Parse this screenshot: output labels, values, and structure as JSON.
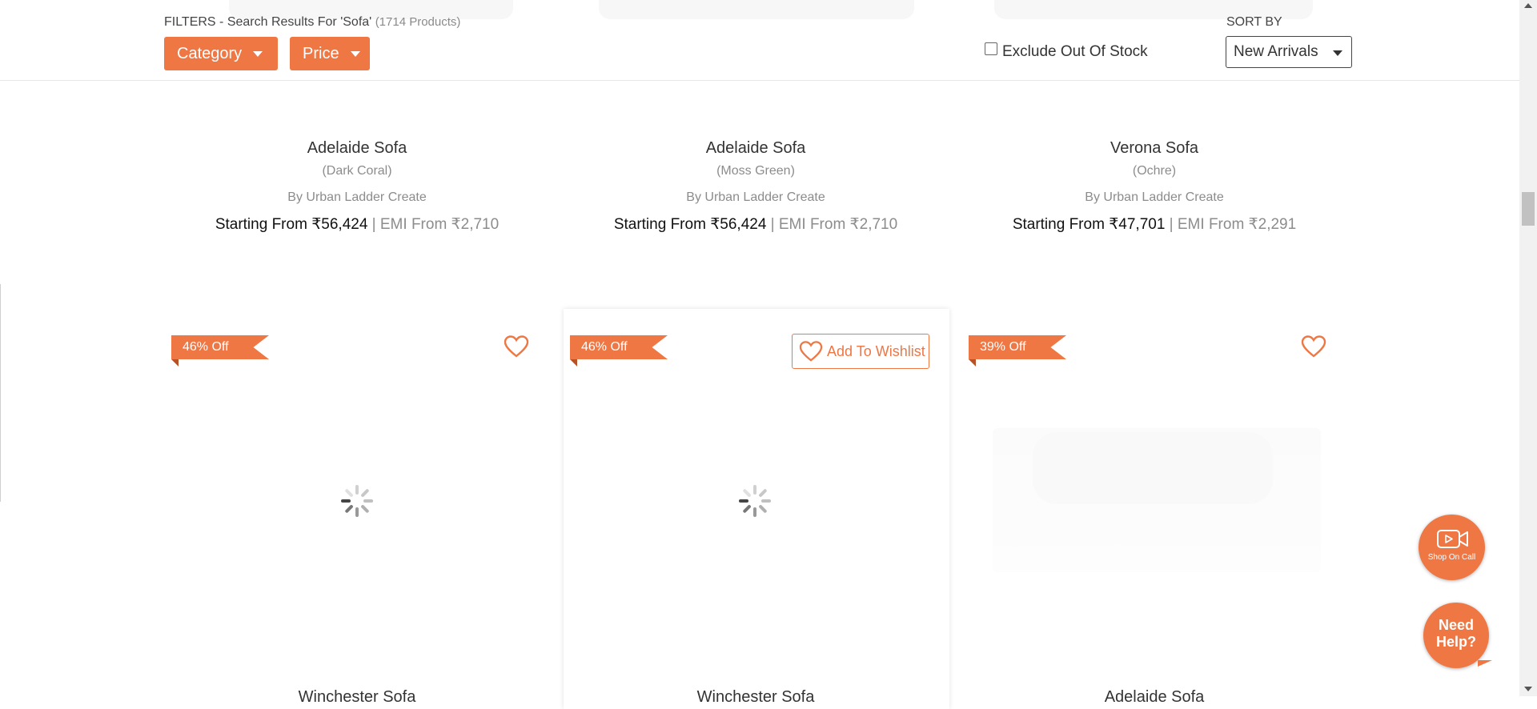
{
  "filters": {
    "title": "FILTERS - Search Results For 'Sofa'",
    "count": "(1714 Products)",
    "category_label": "Category",
    "price_label": "Price",
    "exclude_label": "Exclude Out Of Stock"
  },
  "sort": {
    "label": "SORT BY",
    "selected": "New Arrivals"
  },
  "products": [
    {
      "name": "Adelaide Sofa",
      "variant": "(Dark Coral)",
      "brand": "By Urban Ladder Create",
      "price_prefix": "Starting From ",
      "price": "₹56,424",
      "emi": " | EMI From ₹2,710"
    },
    {
      "name": "Adelaide Sofa",
      "variant": "(Moss Green)",
      "brand": "By Urban Ladder Create",
      "price_prefix": "Starting From ",
      "price": "₹56,424",
      "emi": " | EMI From ₹2,710"
    },
    {
      "name": "Verona Sofa",
      "variant": "(Ochre)",
      "brand": "By Urban Ladder Create",
      "price_prefix": "Starting From ",
      "price": "₹47,701",
      "emi": " | EMI From ₹2,291"
    }
  ],
  "cards": [
    {
      "discount": "46% Off",
      "name_cut": "Winchester Sofa"
    },
    {
      "discount": "46% Off",
      "wishlist_label": "Add To Wishlist",
      "name_cut": "Winchester Sofa"
    },
    {
      "discount": "39% Off",
      "name_cut": "Adelaide Sofa"
    }
  ],
  "floating": {
    "shop_on_call": "Shop On Call",
    "need_help": "Need Help?"
  },
  "colors": {
    "accent": "#ee7744",
    "ribbon_fold": "#b55228"
  },
  "icons": [
    "chevron-down-icon",
    "heart-icon",
    "video-call-icon",
    "loading-spinner-icon"
  ]
}
